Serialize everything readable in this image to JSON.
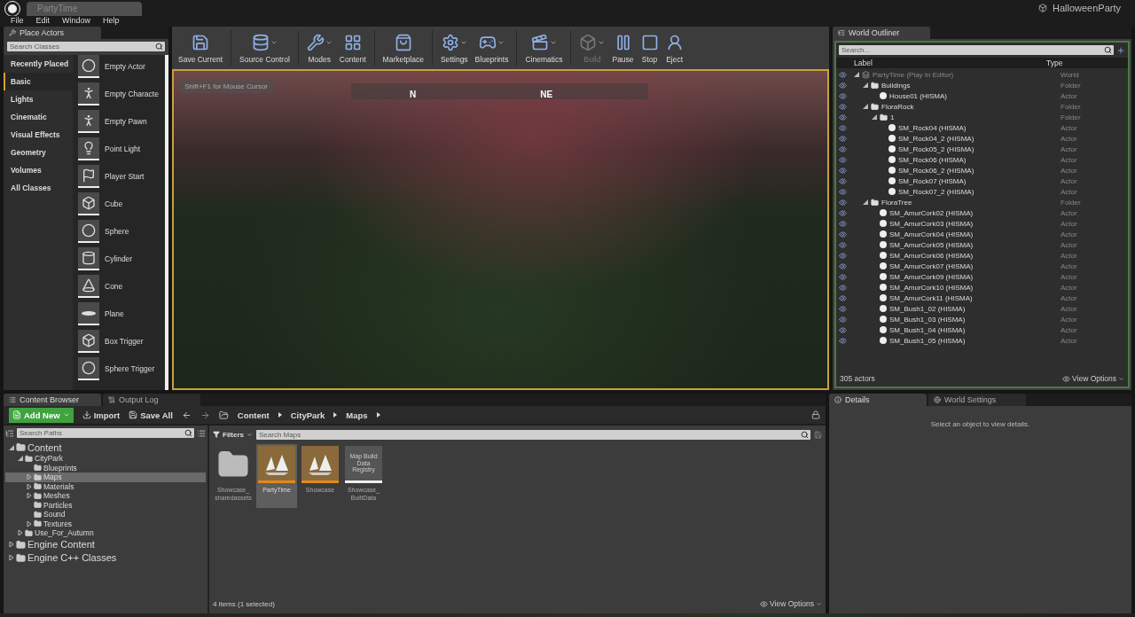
{
  "window": {
    "title": "PartyTime",
    "project": "HalloweenParty"
  },
  "menu": [
    "File",
    "Edit",
    "Window",
    "Help"
  ],
  "place_actors": {
    "tab": "Place Actors",
    "search": {
      "placeholder": "Search Classes"
    },
    "categories": [
      {
        "label": "Recently Placed",
        "selected": false
      },
      {
        "label": "Basic",
        "selected": true
      },
      {
        "label": "Lights",
        "selected": false
      },
      {
        "label": "Cinematic",
        "selected": false
      },
      {
        "label": "Visual Effects",
        "selected": false
      },
      {
        "label": "Geometry",
        "selected": false
      },
      {
        "label": "Volumes",
        "selected": false
      },
      {
        "label": "All Classes",
        "selected": false
      }
    ],
    "items": [
      "Empty Actor",
      "Empty Characte",
      "Empty Pawn",
      "Point Light",
      "Player Start",
      "Cube",
      "Sphere",
      "Cylinder",
      "Cone",
      "Plane",
      "Box Trigger",
      "Sphere Trigger"
    ]
  },
  "toolbar": [
    {
      "label": "Save Current",
      "menu": false,
      "disabled": false
    },
    {
      "label": "Source Control",
      "menu": true,
      "disabled": false
    },
    {
      "label": "Modes",
      "menu": true,
      "disabled": false
    },
    {
      "label": "Content",
      "menu": false,
      "disabled": false
    },
    {
      "label": "Marketplace",
      "menu": false,
      "disabled": false
    },
    {
      "label": "Settings",
      "menu": true,
      "disabled": false
    },
    {
      "label": "Blueprints",
      "menu": true,
      "disabled": false
    },
    {
      "label": "Cinematics",
      "menu": true,
      "disabled": false
    },
    {
      "label": "Build",
      "menu": true,
      "disabled": true
    },
    {
      "label": "Pause",
      "menu": false,
      "disabled": false
    },
    {
      "label": "Stop",
      "menu": false,
      "disabled": false
    },
    {
      "label": "Eject",
      "menu": false,
      "disabled": false
    }
  ],
  "viewport": {
    "hint": "Shift+F1 for Mouse Cursor",
    "compass": [
      "N",
      "NE"
    ]
  },
  "outliner": {
    "tab": "World Outliner",
    "search": {
      "placeholder": "Search..."
    },
    "columns": [
      "Label",
      "Type"
    ],
    "tree": [
      {
        "label": "PartyTime (Play In Editor)",
        "type": "World",
        "kind": "world",
        "expanded": true,
        "children": [
          {
            "label": "Buildings",
            "type": "Folder",
            "kind": "folder",
            "expanded": true,
            "children": [
              {
                "label": "House01 (HISMA)",
                "type": "Actor",
                "kind": "actor"
              }
            ]
          },
          {
            "label": "FloraRock",
            "type": "Folder",
            "kind": "folder",
            "expanded": true,
            "children": [
              {
                "label": "1",
                "type": "Folder",
                "kind": "folder",
                "expanded": true,
                "children": [
                  {
                    "label": "SM_Rock04 (HISMA)",
                    "type": "Actor",
                    "kind": "actor"
                  },
                  {
                    "label": "SM_Rock04_2 (HISMA)",
                    "type": "Actor",
                    "kind": "actor"
                  },
                  {
                    "label": "SM_Rock05_2 (HISMA)",
                    "type": "Actor",
                    "kind": "actor"
                  },
                  {
                    "label": "SM_Rock06 (HISMA)",
                    "type": "Actor",
                    "kind": "actor"
                  },
                  {
                    "label": "SM_Rock06_2 (HISMA)",
                    "type": "Actor",
                    "kind": "actor"
                  },
                  {
                    "label": "SM_Rock07 (HISMA)",
                    "type": "Actor",
                    "kind": "actor"
                  },
                  {
                    "label": "SM_Rock07_2 (HISMA)",
                    "type": "Actor",
                    "kind": "actor"
                  }
                ]
              }
            ]
          },
          {
            "label": "FloraTree",
            "type": "Folder",
            "kind": "folder",
            "expanded": true,
            "children": [
              {
                "label": "SM_AmurCork02 (HISMA)",
                "type": "Actor",
                "kind": "actor"
              },
              {
                "label": "SM_AmurCork03 (HISMA)",
                "type": "Actor",
                "kind": "actor"
              },
              {
                "label": "SM_AmurCork04 (HISMA)",
                "type": "Actor",
                "kind": "actor"
              },
              {
                "label": "SM_AmurCork05 (HISMA)",
                "type": "Actor",
                "kind": "actor"
              },
              {
                "label": "SM_AmurCork06 (HISMA)",
                "type": "Actor",
                "kind": "actor"
              },
              {
                "label": "SM_AmurCork07 (HISMA)",
                "type": "Actor",
                "kind": "actor"
              },
              {
                "label": "SM_AmurCork09 (HISMA)",
                "type": "Actor",
                "kind": "actor"
              },
              {
                "label": "SM_AmurCork10 (HISMA)",
                "type": "Actor",
                "kind": "actor"
              },
              {
                "label": "SM_AmurCork11 (HISMA)",
                "type": "Actor",
                "kind": "actor"
              },
              {
                "label": "SM_Bush1_02 (HISMA)",
                "type": "Actor",
                "kind": "actor"
              },
              {
                "label": "SM_Bush1_03 (HISMA)",
                "type": "Actor",
                "kind": "actor"
              },
              {
                "label": "SM_Bush1_04 (HISMA)",
                "type": "Actor",
                "kind": "actor"
              },
              {
                "label": "SM_Bush1_05 (HISMA)",
                "type": "Actor",
                "kind": "actor"
              }
            ]
          }
        ]
      }
    ],
    "count": "305 actors",
    "view_options": "View Options"
  },
  "content_browser": {
    "tabs": [
      {
        "label": "Content Browser",
        "selected": true
      },
      {
        "label": "Output Log",
        "selected": false
      }
    ],
    "add_new": "Add New",
    "import": "Import",
    "save_all": "Save All",
    "breadcrumb": [
      "Content",
      "CityPark",
      "Maps"
    ],
    "path_search": {
      "placeholder": "Search Paths"
    },
    "paths": [
      {
        "label": "Content",
        "large": true,
        "expanded": true,
        "selected": false,
        "children": [
          {
            "label": "CityPark",
            "large": false,
            "expanded": true,
            "selected": false,
            "children": [
              {
                "label": "Blueprints",
                "large": false,
                "selected": false
              },
              {
                "label": "Maps",
                "large": false,
                "expanded": false,
                "selected": true
              },
              {
                "label": "Materials",
                "large": false,
                "expanded": false,
                "selected": false
              },
              {
                "label": "Meshes",
                "large": false,
                "expanded": false,
                "selected": false
              },
              {
                "label": "Particles",
                "large": false,
                "selected": false
              },
              {
                "label": "Sound",
                "large": false,
                "selected": false
              },
              {
                "label": "Textures",
                "large": false,
                "expanded": false,
                "selected": false
              }
            ]
          },
          {
            "label": "Use_For_Autumn",
            "large": false,
            "expanded": false,
            "selected": false
          }
        ]
      },
      {
        "label": "Engine Content",
        "large": true,
        "expanded": false,
        "selected": false
      },
      {
        "label": "Engine C++ Classes",
        "large": true,
        "expanded": false,
        "selected": false
      }
    ],
    "filters": "Filters",
    "asset_search": {
      "placeholder": "Search Maps"
    },
    "assets": [
      {
        "name": "Showcase_ sharedassets",
        "kind": "folder",
        "selected": false
      },
      {
        "name": "PartyTime",
        "kind": "map",
        "selected": true
      },
      {
        "name": "Showcase",
        "kind": "map",
        "selected": false
      },
      {
        "name": "Showcase_ BuiltData",
        "kind": "registry",
        "thumb_text": "Map Build Data Registry",
        "selected": false
      }
    ],
    "status": "4 items (1 selected)",
    "view_options": "View Options"
  },
  "details": {
    "tabs": [
      {
        "label": "Details",
        "selected": true
      },
      {
        "label": "World Settings",
        "selected": false
      }
    ],
    "message": "Select an object to view details."
  }
}
